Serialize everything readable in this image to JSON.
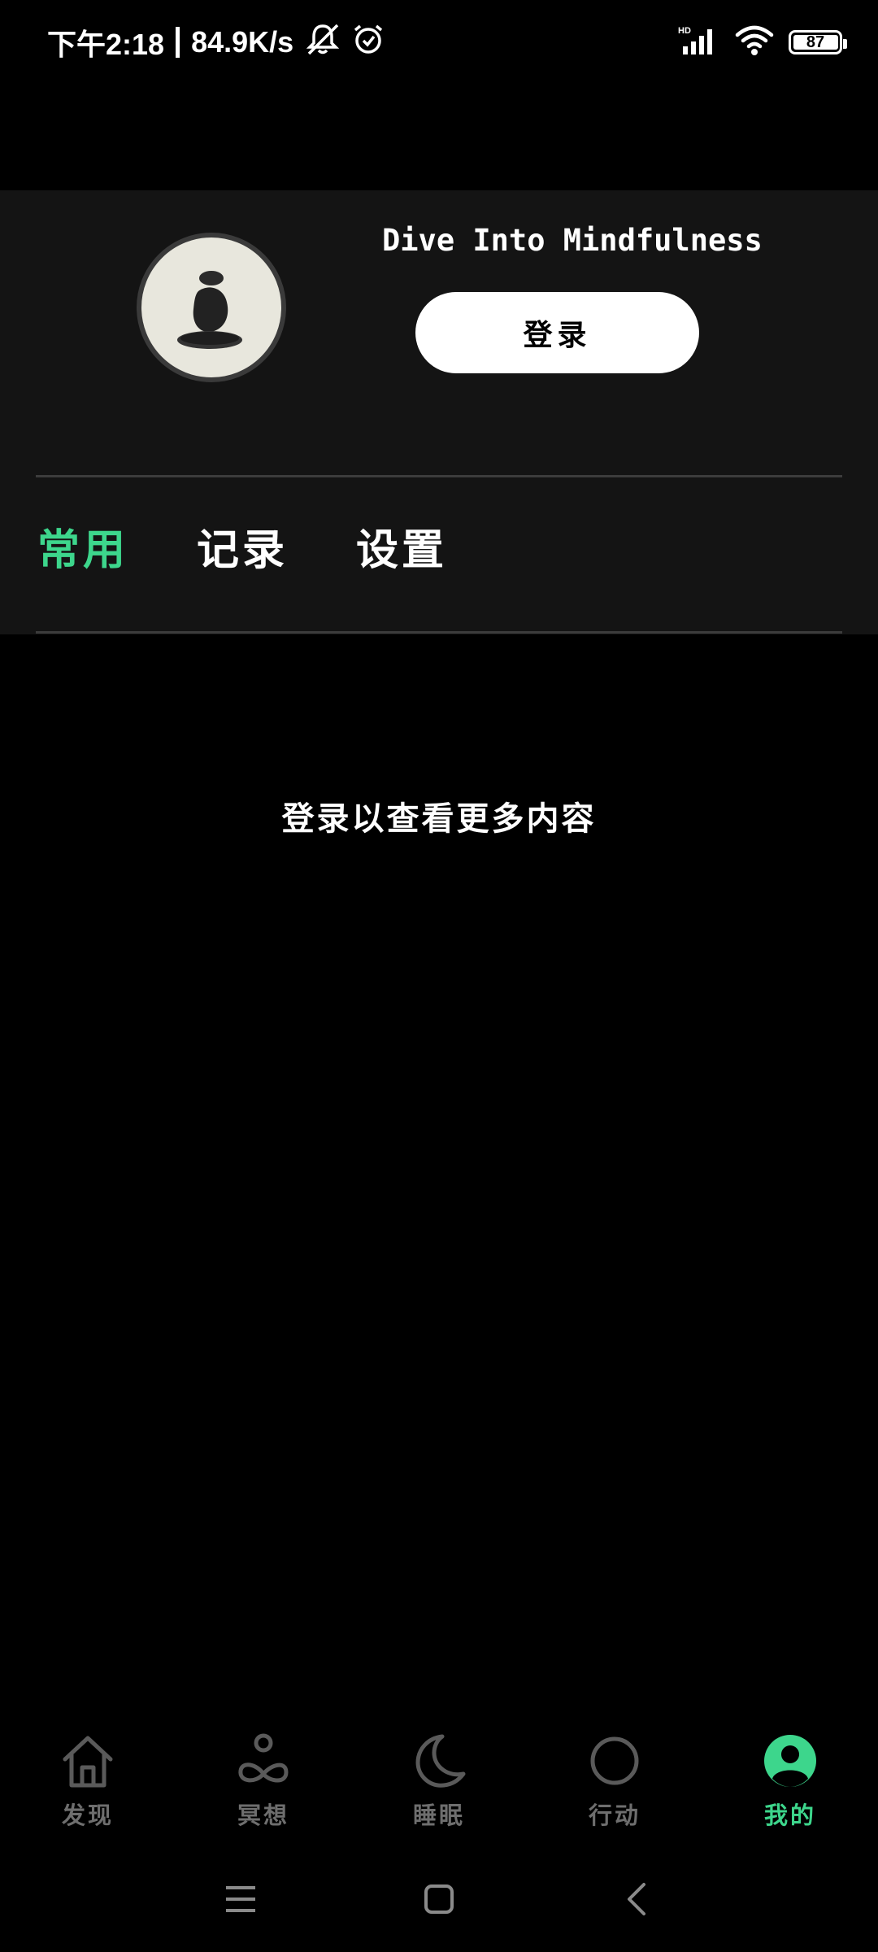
{
  "status_bar": {
    "time": "下午2:18",
    "net_speed": "84.9K/s",
    "network_type": "HD",
    "battery_level": "87",
    "icons": [
      "mute-icon",
      "alarm-icon",
      "signal-icon",
      "wifi-icon",
      "battery-icon"
    ]
  },
  "profile": {
    "tagline": "Dive Into Mindfulness",
    "login_label": "登录",
    "avatar_icon": "stacked-stones-icon"
  },
  "tabs": [
    {
      "label": "常用",
      "active": true
    },
    {
      "label": "记录",
      "active": false
    },
    {
      "label": "设置",
      "active": false
    }
  ],
  "main": {
    "login_prompt": "登录以查看更多内容"
  },
  "bottom_nav": [
    {
      "label": "发现",
      "icon": "home-icon",
      "active": false
    },
    {
      "label": "冥想",
      "icon": "meditation-icon",
      "active": false
    },
    {
      "label": "睡眠",
      "icon": "moon-icon",
      "active": false
    },
    {
      "label": "行动",
      "icon": "circle-icon",
      "active": false
    },
    {
      "label": "我的",
      "icon": "profile-icon",
      "active": true
    }
  ],
  "colors": {
    "accent": "#3dd68c",
    "background": "#000000",
    "panel": "#141414",
    "inactive": "#6e6e6e"
  }
}
